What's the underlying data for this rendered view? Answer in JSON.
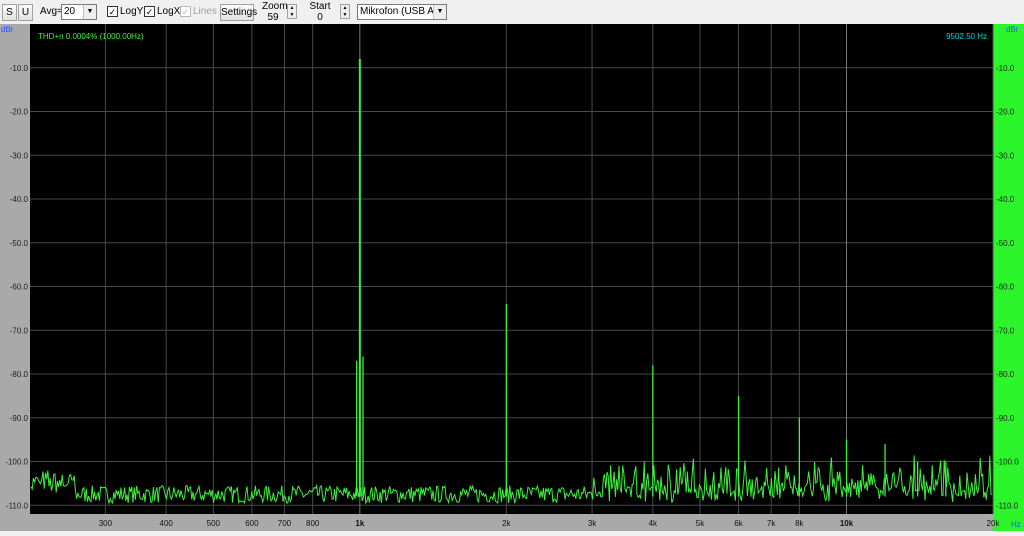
{
  "toolbar": {
    "s_label": "S",
    "u_label": "U",
    "avg_label": "Avg=",
    "avg_value": "20",
    "logy_label": "LogY",
    "logx_label": "LogX",
    "lines_label": "Lines",
    "settings_label": "Settings",
    "zoom_label": "Zoom",
    "zoom_value": "59",
    "start_label": "Start",
    "start_value": "0",
    "device_value": "Mikrofon (USB Audi"
  },
  "plot": {
    "thd_readout": "THD+n 0.0004% (1000.00Hz)",
    "freq_readout": "9502.50 Hz",
    "left_unit": "dBr",
    "right_unit": "dBr",
    "hz_unit": "Hz",
    "colors": {
      "trace": "#3cf03c",
      "background": "#000000",
      "grid": "#4a4a4a",
      "right_axis": "#2cf52c",
      "left_axis": "#a9a9a9",
      "unit_text": "#2255ff",
      "thd_text": "#3cf03c",
      "freq_text": "#00d8d8"
    }
  },
  "chart_data": {
    "type": "line",
    "title": "",
    "xlabel": "Hz",
    "ylabel": "dBr",
    "x_scale": "log",
    "xlim": [
      210,
      20000
    ],
    "ylim": [
      -112,
      0
    ],
    "grid": true,
    "y_ticks": [
      "-10.0",
      "-20.0",
      "-30.0",
      "-40.0",
      "-50.0",
      "-60.0",
      "-70.0",
      "-80.0",
      "-90.0",
      "-100.0",
      "-110.0"
    ],
    "x_ticks": [
      "300",
      "400",
      "500",
      "600",
      "700",
      "800",
      "1k",
      "2k",
      "3k",
      "4k",
      "5k",
      "6k",
      "7k",
      "8k",
      "10k",
      "20k"
    ],
    "x_ticks_bold": [
      "1k",
      "10k"
    ],
    "noise_floor_db": -108,
    "peaks": [
      {
        "freq": 985,
        "db": -77
      },
      {
        "freq": 1000,
        "db": -8
      },
      {
        "freq": 1015,
        "db": -76
      },
      {
        "freq": 2000,
        "db": -64
      },
      {
        "freq": 4000,
        "db": -78
      },
      {
        "freq": 6000,
        "db": -85
      },
      {
        "freq": 8000,
        "db": -90
      },
      {
        "freq": 10000,
        "db": -95
      },
      {
        "freq": 12000,
        "db": -96
      },
      {
        "freq": 14000,
        "db": -100
      },
      {
        "freq": 16000,
        "db": -100
      }
    ]
  }
}
